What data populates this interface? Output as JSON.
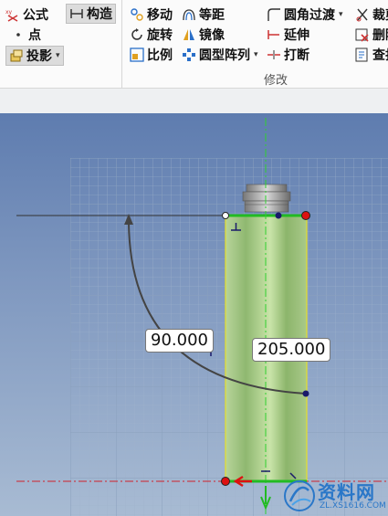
{
  "ribbon": {
    "tools": {
      "formula": "公式",
      "construct": "构造",
      "point": "点",
      "project": "投影",
      "move": "移动",
      "equidistant": "等距",
      "fillet": "圆角过渡",
      "trim": "裁剪",
      "rotate": "旋转",
      "mirror": "镜像",
      "extend": "延伸",
      "delete": "删除",
      "scale": "比例",
      "circular_array": "圆型阵列",
      "break": "打断",
      "find": "查找"
    },
    "group_label": "修改"
  },
  "dimensions": {
    "angle": "90.000",
    "length": "205.000"
  },
  "colors": {
    "viewport_top": "#5e7caf",
    "cylinder": "#9fc47e",
    "selection_green": "#22bb22",
    "endpoint_red": "#dd1111"
  },
  "watermark": {
    "title": "资料网",
    "url": "ZL.XS1616.COM"
  }
}
